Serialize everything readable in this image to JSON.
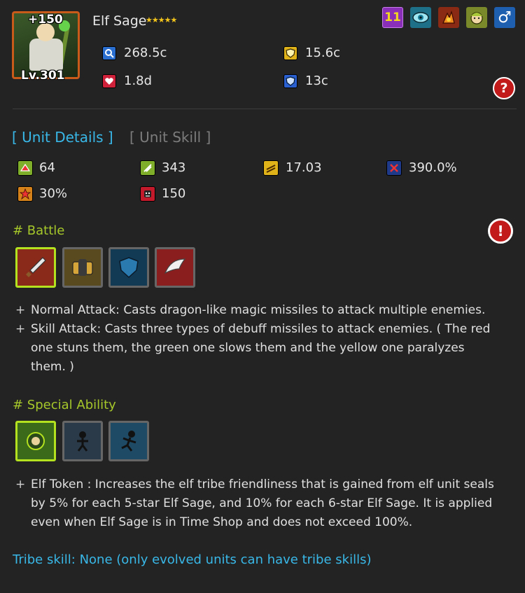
{
  "unit": {
    "name": "Elf Sage",
    "stars": "★★★★★",
    "plus": "+150",
    "level": "Lv.301"
  },
  "top_icons": [
    {
      "name": "number-badge-icon",
      "text": "11",
      "color": "#8a2fb8"
    },
    {
      "name": "eye-icon",
      "text": "",
      "color": "#1e6f88"
    },
    {
      "name": "fire-dragon-icon",
      "text": "",
      "color": "#8a2a14"
    },
    {
      "name": "elf-face-icon",
      "text": "",
      "color": "#7a8a2a"
    },
    {
      "name": "male-gender-icon",
      "text": "♂",
      "color": "#1e5fb0"
    }
  ],
  "stats": {
    "magic_attack": "268.5c",
    "physical_defense": "15.6c",
    "health": "1.8d",
    "magic_defense": "13c"
  },
  "help_label": "?",
  "tabs": {
    "details": "[ Unit Details ]",
    "skill": "[ Unit Skill ]"
  },
  "details": {
    "attack_speed": "64",
    "move_speed": "343",
    "range": "17.03",
    "crit_damage": "390.0%",
    "crit_chance": "30%",
    "mana": "150"
  },
  "battle": {
    "heading": "# Battle",
    "alert_label": "!",
    "skills": [
      {
        "name": "sword-skill-icon",
        "color": "#8a2a1a"
      },
      {
        "name": "bag-skill-icon",
        "color": "#5a4a20"
      },
      {
        "name": "shield-skill-icon",
        "color": "#133a55"
      },
      {
        "name": "wing-skill-icon",
        "color": "#8a1e1e"
      }
    ],
    "lines": [
      "Normal Attack: Casts dragon-like magic missiles to attack multiple enemies.",
      "Skill Attack: Casts three types of debuff missiles to attack enemies. ( The red",
      "one stuns them, the green one slows them and the yellow one paralyzes",
      "them. )"
    ]
  },
  "special": {
    "heading": "# Special Ability",
    "skills": [
      {
        "name": "elf-token-skill-icon",
        "color": "#3a6a1a"
      },
      {
        "name": "jumping-figure-skill-icon",
        "color": "#2a3a48"
      },
      {
        "name": "running-figure-skill-icon",
        "color": "#1e4a66"
      }
    ],
    "lines": [
      "Elf Token : Increases the elf tribe friendliness that is gained from elf unit seals",
      "by 5% for each 5-star Elf Sage, and 10% for each 6-star Elf Sage. It is applied",
      "even when Elf Sage is in Time Shop and does not exceed 100%."
    ]
  },
  "tribe_skill": "Tribe skill: None (only evolved units can have tribe skills)",
  "bullet": "+"
}
